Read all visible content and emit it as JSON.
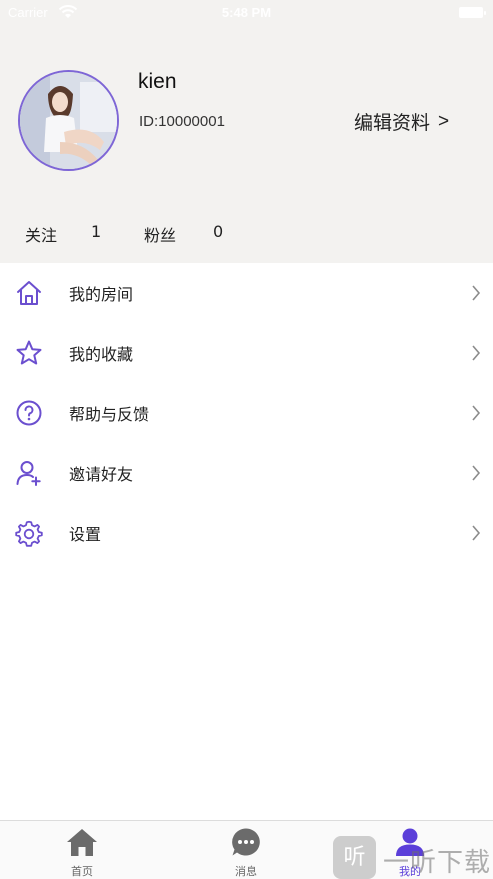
{
  "status_bar": {
    "carrier": "Carrier",
    "time": "5:48 PM"
  },
  "profile": {
    "username": "kien",
    "user_id": "ID:10000001",
    "edit_label": "编辑资料",
    "edit_chevron": ">"
  },
  "stats": {
    "following_label": "关注",
    "following_count": "1",
    "fans_label": "粉丝",
    "fans_count": "0"
  },
  "menu": {
    "items": [
      {
        "label": "我的房间",
        "icon": "home-icon"
      },
      {
        "label": "我的收藏",
        "icon": "star-icon"
      },
      {
        "label": "帮助与反馈",
        "icon": "help-icon"
      },
      {
        "label": "邀请好友",
        "icon": "add-user-icon"
      },
      {
        "label": "设置",
        "icon": "gear-icon"
      }
    ]
  },
  "tab_bar": {
    "tabs": [
      {
        "label": "首页",
        "icon": "home-icon"
      },
      {
        "label": "消息",
        "icon": "message-icon"
      },
      {
        "label": "我的",
        "icon": "user-icon"
      }
    ],
    "active_tab": "我的"
  },
  "watermark": {
    "badge": "听",
    "text": "一听下载"
  },
  "colors": {
    "accent": "#5b3fd9",
    "icon_purple": "#6b4fcf",
    "header_bg": "#f3f2f0",
    "tab_inactive": "#6b6b6b"
  }
}
